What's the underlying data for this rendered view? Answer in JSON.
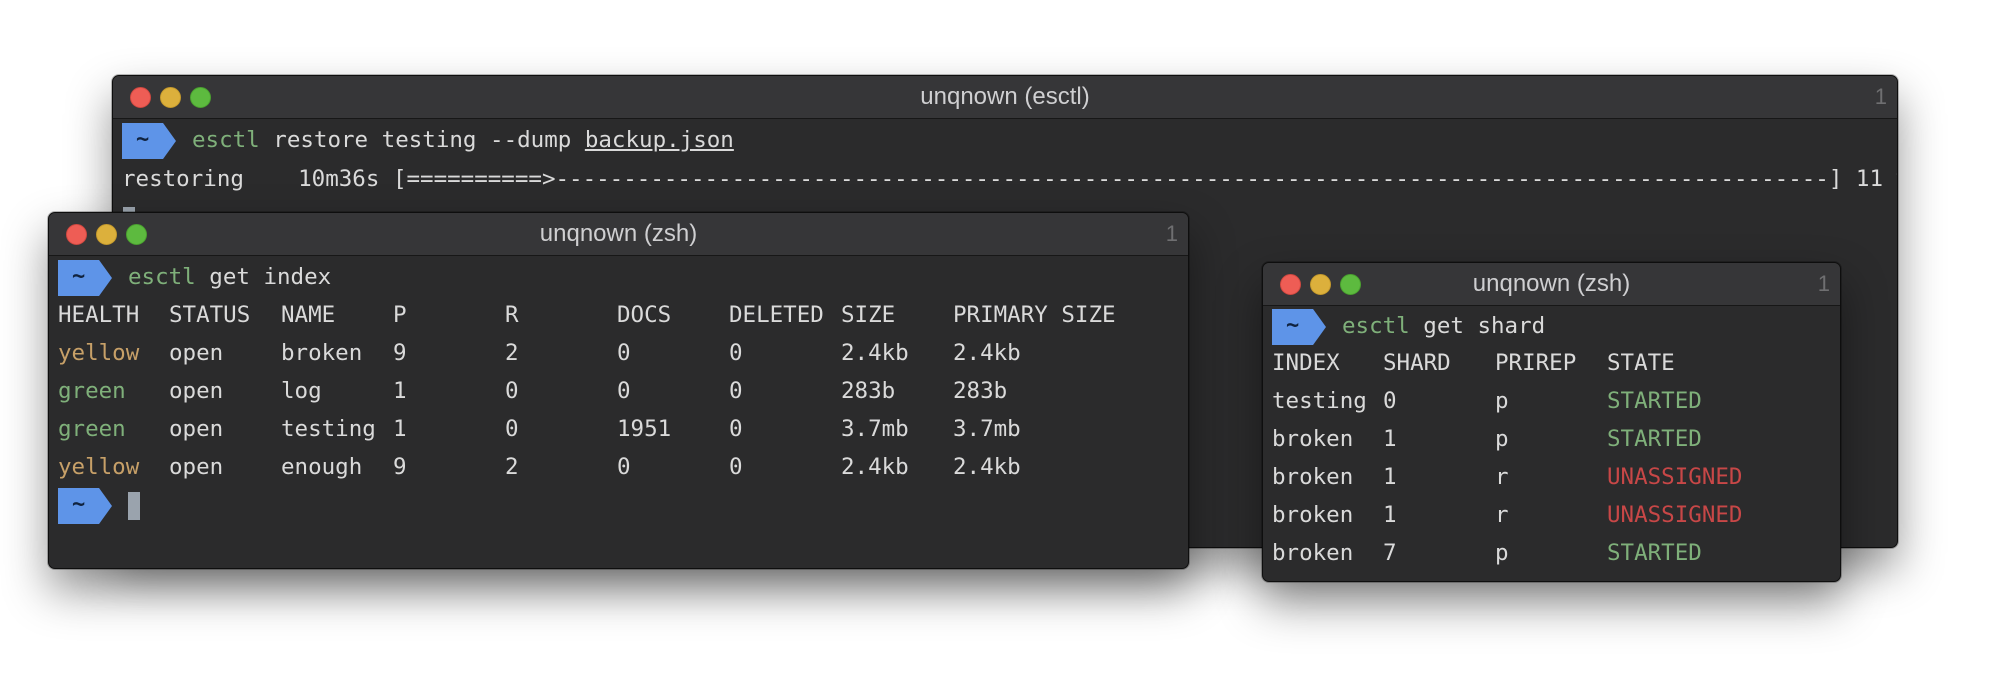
{
  "windows": {
    "restore": {
      "title": "unqnown (esctl)",
      "tab_number": "1",
      "prompt_symbol": "~",
      "command": "esctl",
      "args": "restore testing --dump",
      "file_arg": "backup.json",
      "progress_label": "restoring",
      "elapsed": "10m36s",
      "progress_bar": "[==========>----------------------------------------------------------------------------------------------]",
      "progress_percent": "11 %",
      "progress_value": 0.11
    },
    "index": {
      "title": "unqnown (zsh)",
      "tab_number": "1",
      "prompt_symbol": "~",
      "command": "esctl",
      "args": "get index",
      "headers": [
        "HEALTH",
        "STATUS",
        "NAME",
        "P",
        "R",
        "DOCS",
        "DELETED",
        "SIZE",
        "PRIMARY SIZE"
      ],
      "rows": [
        {
          "health": "yellow",
          "status": "open",
          "name": "broken",
          "p": "9",
          "r": "2",
          "docs": "0",
          "deleted": "0",
          "size": "2.4kb",
          "primary_size": "2.4kb"
        },
        {
          "health": "green",
          "status": "open",
          "name": "log",
          "p": "1",
          "r": "0",
          "docs": "0",
          "deleted": "0",
          "size": "283b",
          "primary_size": "283b"
        },
        {
          "health": "green",
          "status": "open",
          "name": "testing",
          "p": "1",
          "r": "0",
          "docs": "1951",
          "deleted": "0",
          "size": "3.7mb",
          "primary_size": "3.7mb"
        },
        {
          "health": "yellow",
          "status": "open",
          "name": "enough",
          "p": "9",
          "r": "2",
          "docs": "0",
          "deleted": "0",
          "size": "2.4kb",
          "primary_size": "2.4kb"
        }
      ],
      "second_prompt_symbol": "~"
    },
    "shard": {
      "title": "unqnown (zsh)",
      "tab_number": "1",
      "prompt_symbol": "~",
      "command": "esctl",
      "args": "get shard",
      "headers": [
        "INDEX",
        "SHARD",
        "PRIREP",
        "STATE"
      ],
      "rows": [
        {
          "index": "testing",
          "shard": "0",
          "prirep": "p",
          "state": "STARTED"
        },
        {
          "index": "broken",
          "shard": "1",
          "prirep": "p",
          "state": "STARTED"
        },
        {
          "index": "broken",
          "shard": "1",
          "prirep": "r",
          "state": "UNASSIGNED"
        },
        {
          "index": "broken",
          "shard": "1",
          "prirep": "r",
          "state": "UNASSIGNED"
        },
        {
          "index": "broken",
          "shard": "7",
          "prirep": "p",
          "state": "STARTED"
        }
      ]
    }
  },
  "colors": {
    "prompt_badge": "#5e94e8",
    "command": "#7fb07a",
    "health_yellow": "#c7a068",
    "health_green": "#7fb07a",
    "state_started": "#7fb07a",
    "state_unassigned": "#c84747"
  }
}
